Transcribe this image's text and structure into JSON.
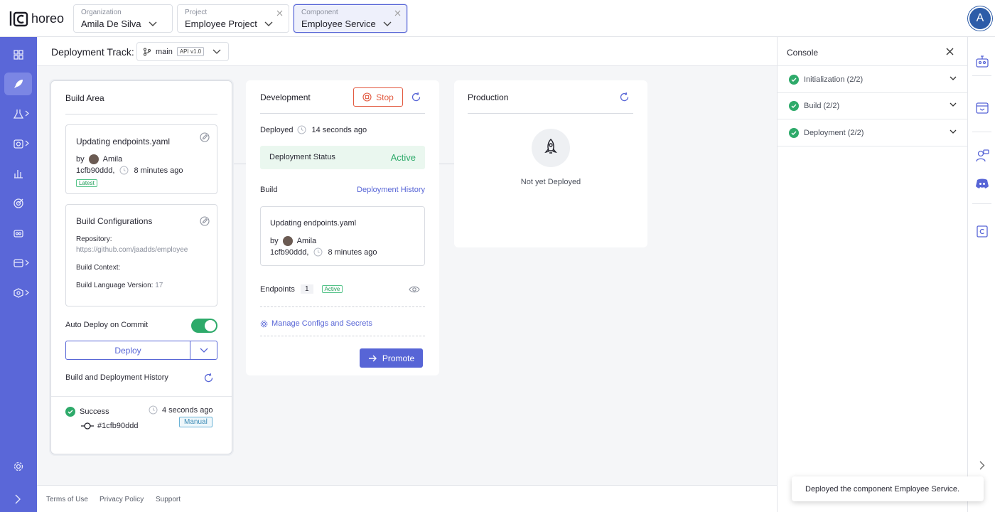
{
  "brand": {
    "logo_text": "horeo"
  },
  "topbar": {
    "organization": {
      "label": "Organization",
      "value": "Amila De Silva"
    },
    "project": {
      "label": "Project",
      "value": "Employee Project"
    },
    "component": {
      "label": "Component",
      "value": "Employee Service"
    },
    "avatar_initial": "A"
  },
  "subheader": {
    "title": "Deployment Track:",
    "branch": "main",
    "api_version": "API v1.0"
  },
  "build_area": {
    "title": "Build Area",
    "commit": {
      "message": "Updating endpoints.yaml",
      "by": "by",
      "author": "Amila",
      "hash": "1cfb90ddd,",
      "time": "8 minutes ago",
      "badge": "Latest"
    },
    "configs": {
      "title": "Build Configurations",
      "repo_label": "Repository:",
      "repo_value": "https://github.com/jaadds/employee",
      "context_label": "Build Context:",
      "lang_label": "Build Language Version:",
      "lang_value": "17"
    },
    "auto_deploy_label": "Auto Deploy on Commit",
    "auto_deploy_on": true,
    "deploy_button": "Deploy",
    "history_title": "Build and Deployment History",
    "history_item": {
      "status": "Success",
      "time": "4 seconds ago",
      "hash": "#1cfb90ddd",
      "trigger": "Manual"
    }
  },
  "development": {
    "title": "Development",
    "stop_button": "Stop",
    "deployed_label": "Deployed",
    "deployed_time": "14 seconds ago",
    "status_label": "Deployment Status",
    "status_value": "Active",
    "build_label": "Build",
    "history_link": "Deployment History",
    "commit": {
      "message": "Updating endpoints.yaml",
      "by": "by",
      "author": "Amila",
      "hash": "1cfb90ddd,",
      "time": "8 minutes ago"
    },
    "endpoints_label": "Endpoints",
    "endpoints_count": "1",
    "endpoints_badge": "Active",
    "manage_link": "Manage Configs and Secrets",
    "promote_button": "Promote"
  },
  "production": {
    "title": "Production",
    "empty_text": "Not yet Deployed"
  },
  "console": {
    "title": "Console",
    "steps": [
      {
        "label": "Initialization (2/2)"
      },
      {
        "label": "Build (2/2)"
      },
      {
        "label": "Deployment (2/2)"
      }
    ]
  },
  "footer": {
    "terms": "Terms of Use",
    "privacy": "Privacy Policy",
    "support": "Support"
  },
  "toast": "Deployed the component Employee Service.",
  "colors": {
    "accent": "#5a67d8",
    "success": "#2eaa6a",
    "danger": "#e2583e"
  }
}
